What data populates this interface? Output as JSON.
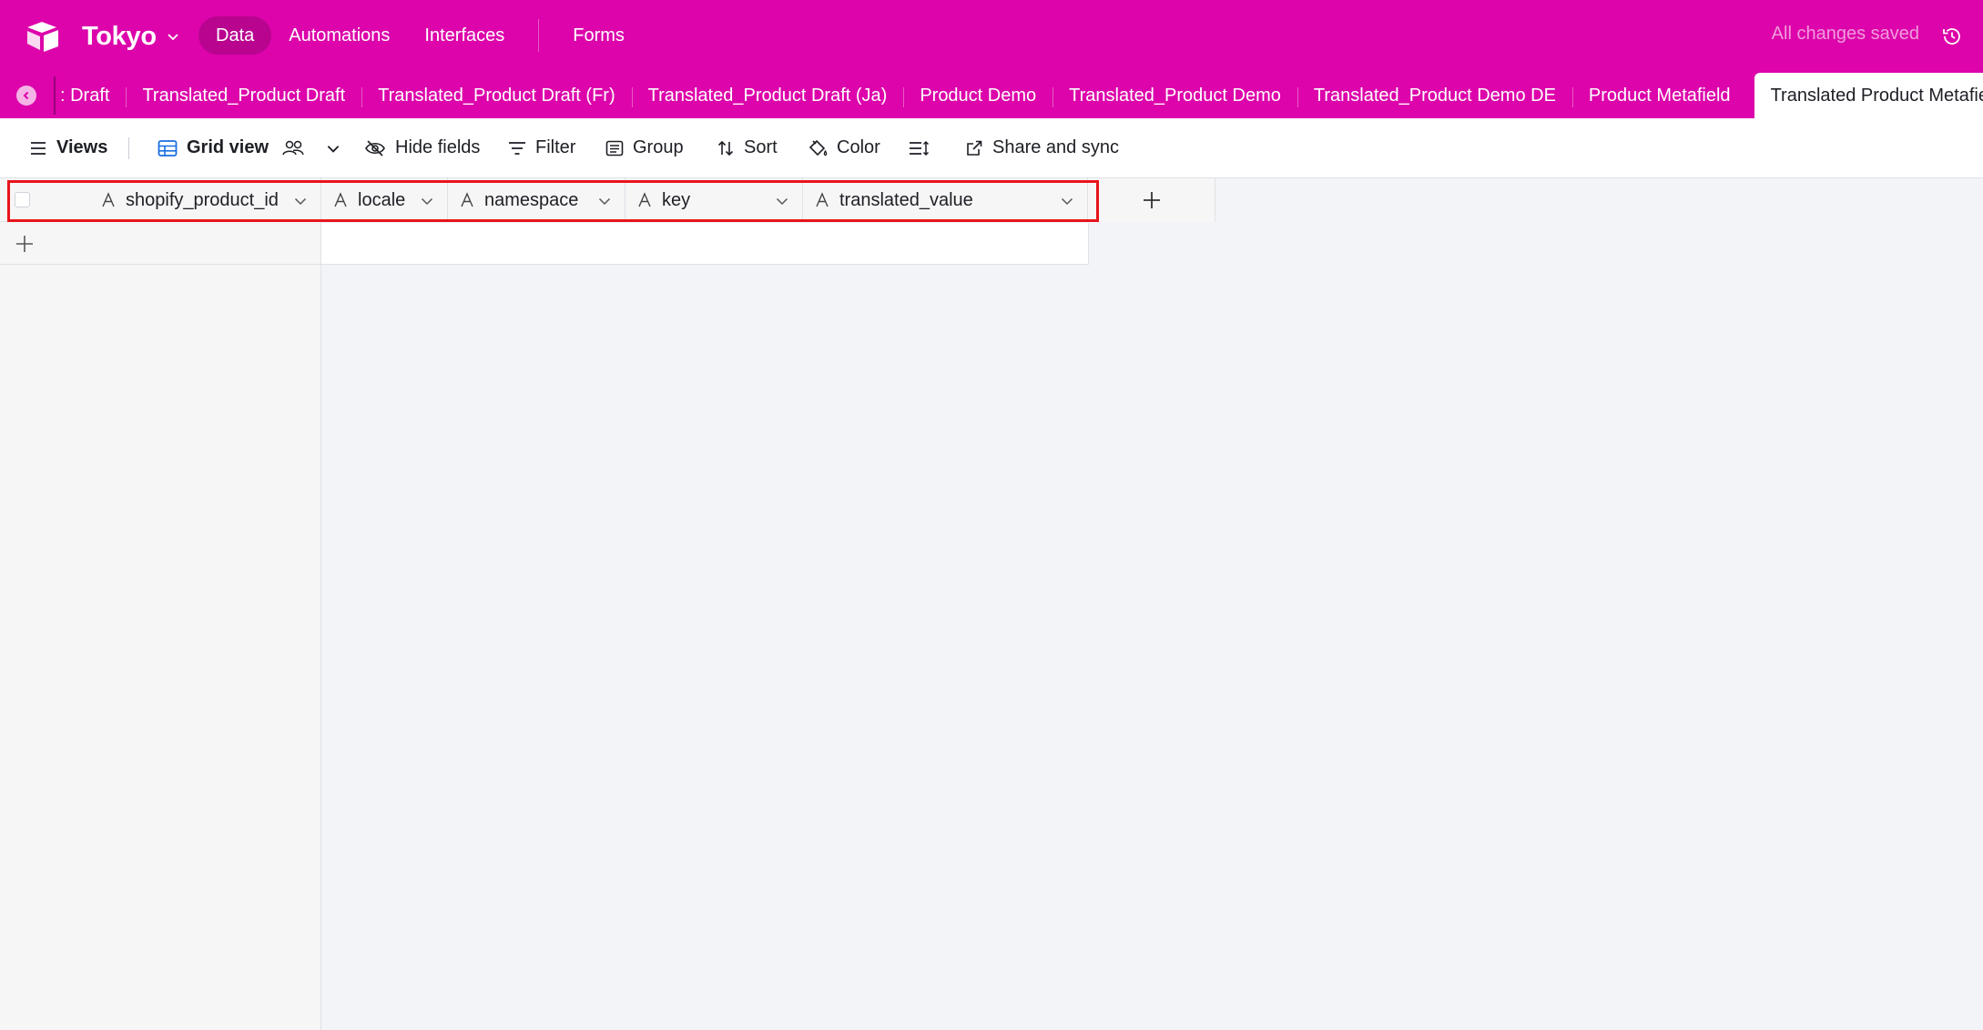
{
  "app": {
    "base_name": "Tokyo",
    "brand_color": "#dc04aa",
    "save_status": "All changes saved"
  },
  "topnav": {
    "items": [
      {
        "label": "Data",
        "active": true
      },
      {
        "label": "Automations",
        "active": false
      },
      {
        "label": "Interfaces",
        "active": false
      },
      {
        "label": "Forms",
        "active": false
      }
    ]
  },
  "tables": {
    "tabs": [
      {
        "label": ": Draft"
      },
      {
        "label": "Translated_Product Draft"
      },
      {
        "label": "Translated_Product Draft (Fr)"
      },
      {
        "label": "Translated_Product Draft (Ja)"
      },
      {
        "label": "Product Demo"
      },
      {
        "label": "Translated_Product Demo"
      },
      {
        "label": "Translated_Product Demo DE"
      },
      {
        "label": "Product Metafield"
      },
      {
        "label": "Translated Product Metafield",
        "active": true
      }
    ]
  },
  "toolbar": {
    "views_label": "Views",
    "grid_view_label": "Grid view",
    "hide_fields_label": "Hide fields",
    "filter_label": "Filter",
    "group_label": "Group",
    "sort_label": "Sort",
    "color_label": "Color",
    "share_label": "Share and sync"
  },
  "grid": {
    "columns": [
      {
        "name": "shopify_product_id",
        "type_icon": "text-field-icon"
      },
      {
        "name": "locale",
        "type_icon": "text-field-icon"
      },
      {
        "name": "namespace",
        "type_icon": "text-field-icon"
      },
      {
        "name": "key",
        "type_icon": "text-field-icon"
      },
      {
        "name": "translated_value",
        "type_icon": "text-field-icon"
      }
    ],
    "highlight_color": "#e8141b"
  }
}
